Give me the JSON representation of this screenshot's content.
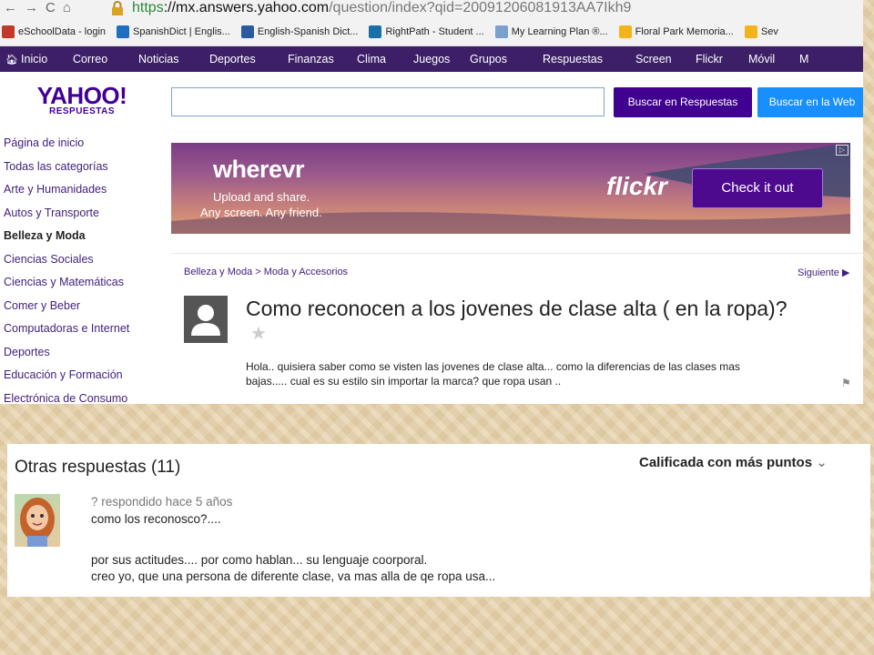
{
  "browser": {
    "url_scheme": "https",
    "url_host": "://mx.answers.yahoo.com",
    "url_path": "/question/index?qid=20091206081913AA7Ikh9",
    "bookmarks": [
      {
        "label": "eSchoolData - login",
        "icon": "esd-icon",
        "color": "#c0392b"
      },
      {
        "label": "SpanishDict | Englis...",
        "icon": "spanishdict-icon",
        "color": "#1f6fc0"
      },
      {
        "label": "English-Spanish Dict...",
        "icon": "wordreference-icon",
        "color": "#2c5aa0"
      },
      {
        "label": "RightPath - Student ...",
        "icon": "rightpath-icon",
        "color": "#1b6fa8"
      },
      {
        "label": "My Learning Plan ®...",
        "icon": "mlp-icon",
        "color": "#7aa0d0"
      },
      {
        "label": "Floral Park Memoria...",
        "icon": "fpm-icon",
        "color": "#f3b41b"
      },
      {
        "label": "Sev",
        "icon": "sev-icon",
        "color": "#f3b41b"
      }
    ]
  },
  "nav": {
    "items": [
      "Inicio",
      "Correo",
      "Noticias",
      "Deportes",
      "Finanzas",
      "Clima",
      "Juegos",
      "Grupos",
      "Respuestas",
      "Screen",
      "Flickr",
      "Móvil",
      "M"
    ]
  },
  "logo": {
    "main": "YAHOO!",
    "sub": "RESPUESTAS"
  },
  "sidebar": {
    "items": [
      {
        "label": "Página de inicio",
        "active": false
      },
      {
        "label": "Todas las categorías",
        "active": false
      },
      {
        "label": "Arte y Humanidades",
        "active": false
      },
      {
        "label": "Autos y Transporte",
        "active": false
      },
      {
        "label": "Belleza y Moda",
        "active": true
      },
      {
        "label": "Ciencias Sociales",
        "active": false
      },
      {
        "label": "Ciencias y Matemáticas",
        "active": false
      },
      {
        "label": "Comer y Beber",
        "active": false
      },
      {
        "label": "Computadoras e Internet",
        "active": false
      },
      {
        "label": "Deportes",
        "active": false
      },
      {
        "label": "Educación y Formación",
        "active": false
      },
      {
        "label": "Electrónica de Consumo",
        "active": false
      }
    ]
  },
  "search": {
    "placeholder": "",
    "button_answers": "Buscar en Respuestas",
    "button_web": "Buscar en la Web"
  },
  "banner": {
    "brand": "wherevr",
    "line1": "Upload and share.",
    "line2": "Any screen. Any friend.",
    "logo": "flickr",
    "cta": "Check it out"
  },
  "question": {
    "breadcrumb": "Belleza y Moda > Moda y Accesorios",
    "next": "Siguiente ▶",
    "title": "Como reconocen a los jovenes de clase alta ( en la ropa)?",
    "body_line1": "Hola.. quisiera saber como se visten las jovenes de clase alta... como la diferencias de las clases mas",
    "body_line2": "bajas..... cual es su estilo sin importar la marca?   que ropa usan .."
  },
  "answers": {
    "title": "Otras respuestas (11)",
    "sort_label": "Calificada con más puntos",
    "items": [
      {
        "meta": "? respondido hace 5 años",
        "line1": "como los reconosco?....",
        "line2": "por sus actitudes.... por como hablan... su lenguaje coorporal.",
        "line3": "creo yo, que una persona de diferente clase, va mas alla de qe ropa usa..."
      }
    ]
  },
  "colors": {
    "yahoo_purple": "#400090",
    "nav_bg": "#3c1f67",
    "web_search_blue": "#188fff",
    "page_background": "#e7d3ad"
  }
}
